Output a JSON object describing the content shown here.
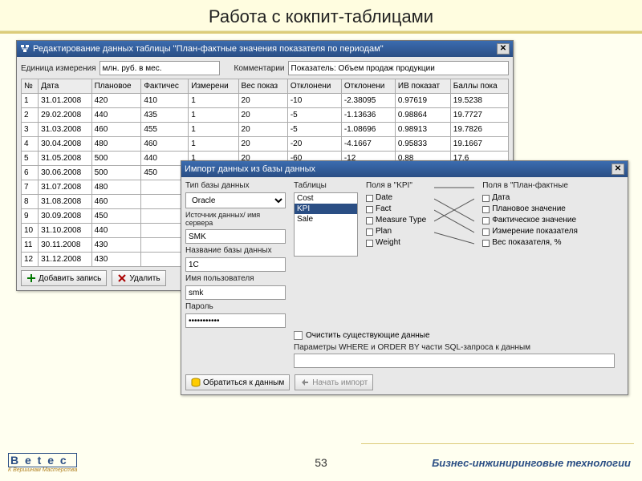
{
  "slide": {
    "title": "Работа с кокпит-таблицами",
    "page": "53"
  },
  "win1": {
    "title": "Редактирование данных таблицы  \"План-фактные значения показателя по периодам\"",
    "unitLabel": "Единица измерения",
    "unitValue": "млн. руб. в мес.",
    "commentLabel": "Комментарии",
    "commentValue": "Показатель: Объем продаж продукции",
    "headers": [
      "№",
      "Дата",
      "Плановое",
      "Фактичес",
      "Измерени",
      "Вес показ",
      "Отклонени",
      "Отклонени",
      "ИВ показат",
      "Баллы пока"
    ],
    "rows": [
      [
        "1",
        "31.01.2008",
        "420",
        "410",
        "1",
        "20",
        "-10",
        "-2.38095",
        "0.97619",
        "19.5238"
      ],
      [
        "2",
        "29.02.2008",
        "440",
        "435",
        "1",
        "20",
        "-5",
        "-1.13636",
        "0.98864",
        "19.7727"
      ],
      [
        "3",
        "31.03.2008",
        "460",
        "455",
        "1",
        "20",
        "-5",
        "-1.08696",
        "0.98913",
        "19.7826"
      ],
      [
        "4",
        "30.04.2008",
        "480",
        "460",
        "1",
        "20",
        "-20",
        "-4.1667",
        "0.95833",
        "19.1667"
      ],
      [
        "5",
        "31.05.2008",
        "500",
        "440",
        "1",
        "20",
        "-60",
        "-12",
        "0.88",
        "17.6"
      ],
      [
        "6",
        "30.06.2008",
        "500",
        "450",
        "",
        "",
        "",
        "",
        "",
        ""
      ],
      [
        "7",
        "31.07.2008",
        "480",
        "",
        "",
        "",
        "",
        "",
        "",
        ""
      ],
      [
        "8",
        "31.08.2008",
        "460",
        "",
        "",
        "",
        "",
        "",
        "",
        ""
      ],
      [
        "9",
        "30.09.2008",
        "450",
        "",
        "",
        "",
        "",
        "",
        "",
        ""
      ],
      [
        "10",
        "31.10.2008",
        "440",
        "",
        "",
        "",
        "",
        "",
        "",
        ""
      ],
      [
        "11",
        "30.11.2008",
        "430",
        "",
        "",
        "",
        "",
        "",
        "",
        ""
      ],
      [
        "12",
        "31.12.2008",
        "430",
        "",
        "",
        "",
        "",
        "",
        "",
        ""
      ]
    ],
    "addBtn": "Добавить запись",
    "delBtn": "Удалить"
  },
  "win2": {
    "title": "Импорт данных из базы данных",
    "dbTypeLabel": "Тип базы данных",
    "dbTypeValue": "Oracle",
    "sourceLabel": "Источник данных/ имя сервера",
    "sourceValue": "SMK",
    "dbNameLabel": "Название базы данных",
    "dbNameValue": "1C",
    "userLabel": "Имя пользователя",
    "userValue": "smk",
    "passLabel": "Пароль",
    "passValue": "***********",
    "tablesLabel": "Таблицы",
    "tables": [
      "Cost",
      "KPI",
      "Sale"
    ],
    "fieldsKpiLabel": "Поля в \"KPI\"",
    "fieldsKpi": [
      "Date",
      "Fact",
      "Measure Type",
      "Plan",
      "Weight"
    ],
    "fieldsPlanLabel": "Поля в \"План-фактные",
    "fieldsPlan": [
      "Дата",
      "Плановое значение",
      "Фактическое значение",
      "Измерение показателя",
      "Вес показателя, %"
    ],
    "clearLabel": "Очистить существующие данные",
    "whereLabel": "Параметры WHERE и ORDER BY части SQL-запроса к данным",
    "connectBtn": "Обратиться к данным",
    "startBtn": "Начать импорт"
  },
  "footer": {
    "logoMain": "B e t e c",
    "logoSub": "К Вершинам Мастерства",
    "brand": "Бизнес-инжиниринговые технологии"
  }
}
